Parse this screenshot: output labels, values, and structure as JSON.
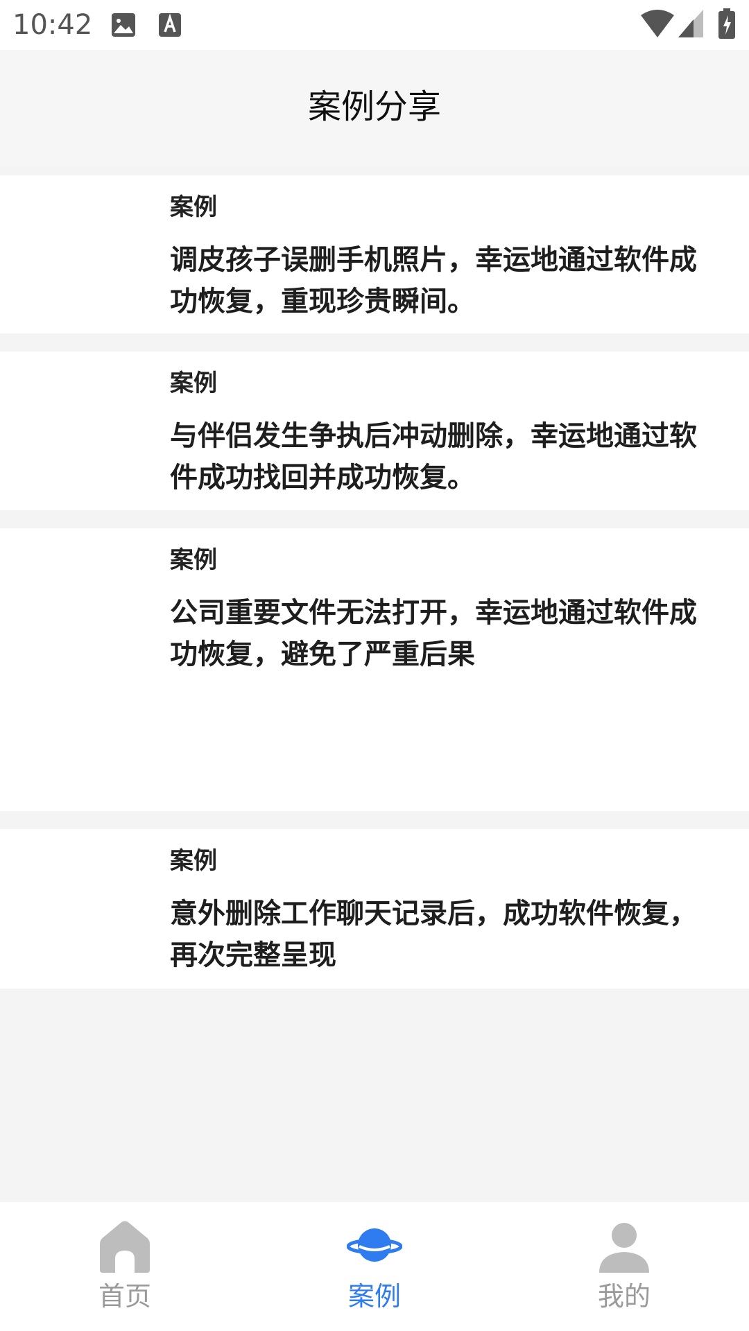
{
  "status_bar": {
    "time": "10:42",
    "icons": [
      "image-icon",
      "font-icon",
      "wifi-icon",
      "signal-icon",
      "battery-charging-icon"
    ]
  },
  "header": {
    "title": "案例分享"
  },
  "cases": [
    {
      "label": "案例",
      "text": "调皮孩子误删手机照片，幸运地通过软件成功恢复，重现珍贵瞬间。"
    },
    {
      "label": "案例",
      "text": "与伴侣发生争执后冲动删除，幸运地通过软件成功找回并成功恢复。"
    },
    {
      "label": "案例",
      "text": "公司重要文件无法打开，幸运地通过软件成功恢复，避免了严重后果"
    },
    {
      "label": "案例",
      "text": "意外删除工作聊天记录后，成功软件恢复，再次完整呈现"
    }
  ],
  "bottom_nav": {
    "items": [
      {
        "label": "首页",
        "icon": "home-icon",
        "active": false
      },
      {
        "label": "案例",
        "icon": "planet-icon",
        "active": true
      },
      {
        "label": "我的",
        "icon": "profile-icon",
        "active": false
      }
    ]
  },
  "colors": {
    "accent": "#2f7cf0",
    "inactive": "#9a9a9a",
    "background": "#f4f4f4",
    "card": "#ffffff"
  }
}
